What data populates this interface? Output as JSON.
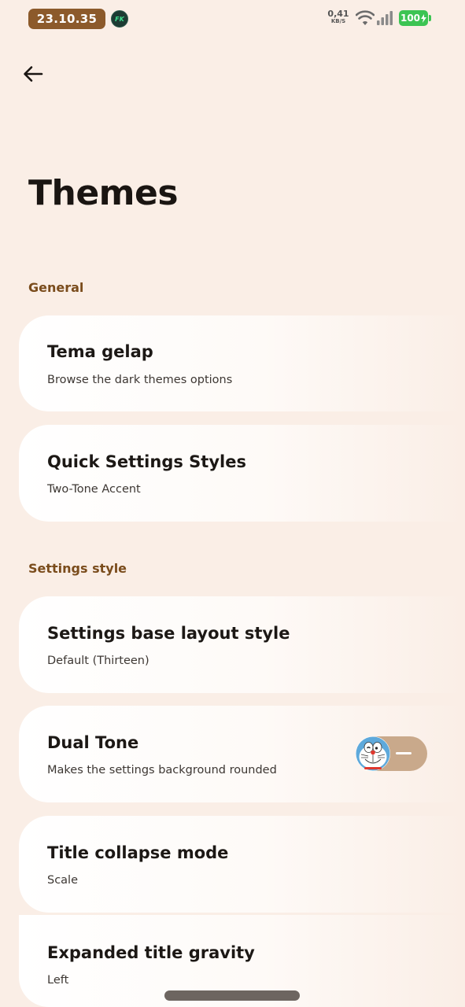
{
  "status_bar": {
    "time": "23.10.35",
    "app_icon_text": "FK",
    "net_speed_value": "0,41",
    "net_speed_unit": "KB/S",
    "battery": "100"
  },
  "header": {
    "back_icon": "arrow-left-icon",
    "title": "Themes"
  },
  "sections": {
    "general": {
      "label": "General",
      "items": [
        {
          "title": "Tema gelap",
          "subtitle": "Browse the dark themes options"
        },
        {
          "title": "Quick Settings Styles",
          "subtitle": "Two-Tone Accent"
        }
      ]
    },
    "settings_style": {
      "label": "Settings style",
      "items": [
        {
          "title": "Settings base layout style",
          "subtitle": "Default (Thirteen)"
        },
        {
          "title": "Dual Tone",
          "subtitle": "Makes the settings background rounded"
        },
        {
          "title": "Title collapse mode",
          "subtitle": "Scale"
        },
        {
          "title": "Expanded title gravity",
          "subtitle": "Left"
        }
      ]
    }
  },
  "colors": {
    "background": "#faeee6",
    "accent": "#8c5a2b",
    "section_header": "#7a4c1c",
    "battery": "#3cc453"
  }
}
